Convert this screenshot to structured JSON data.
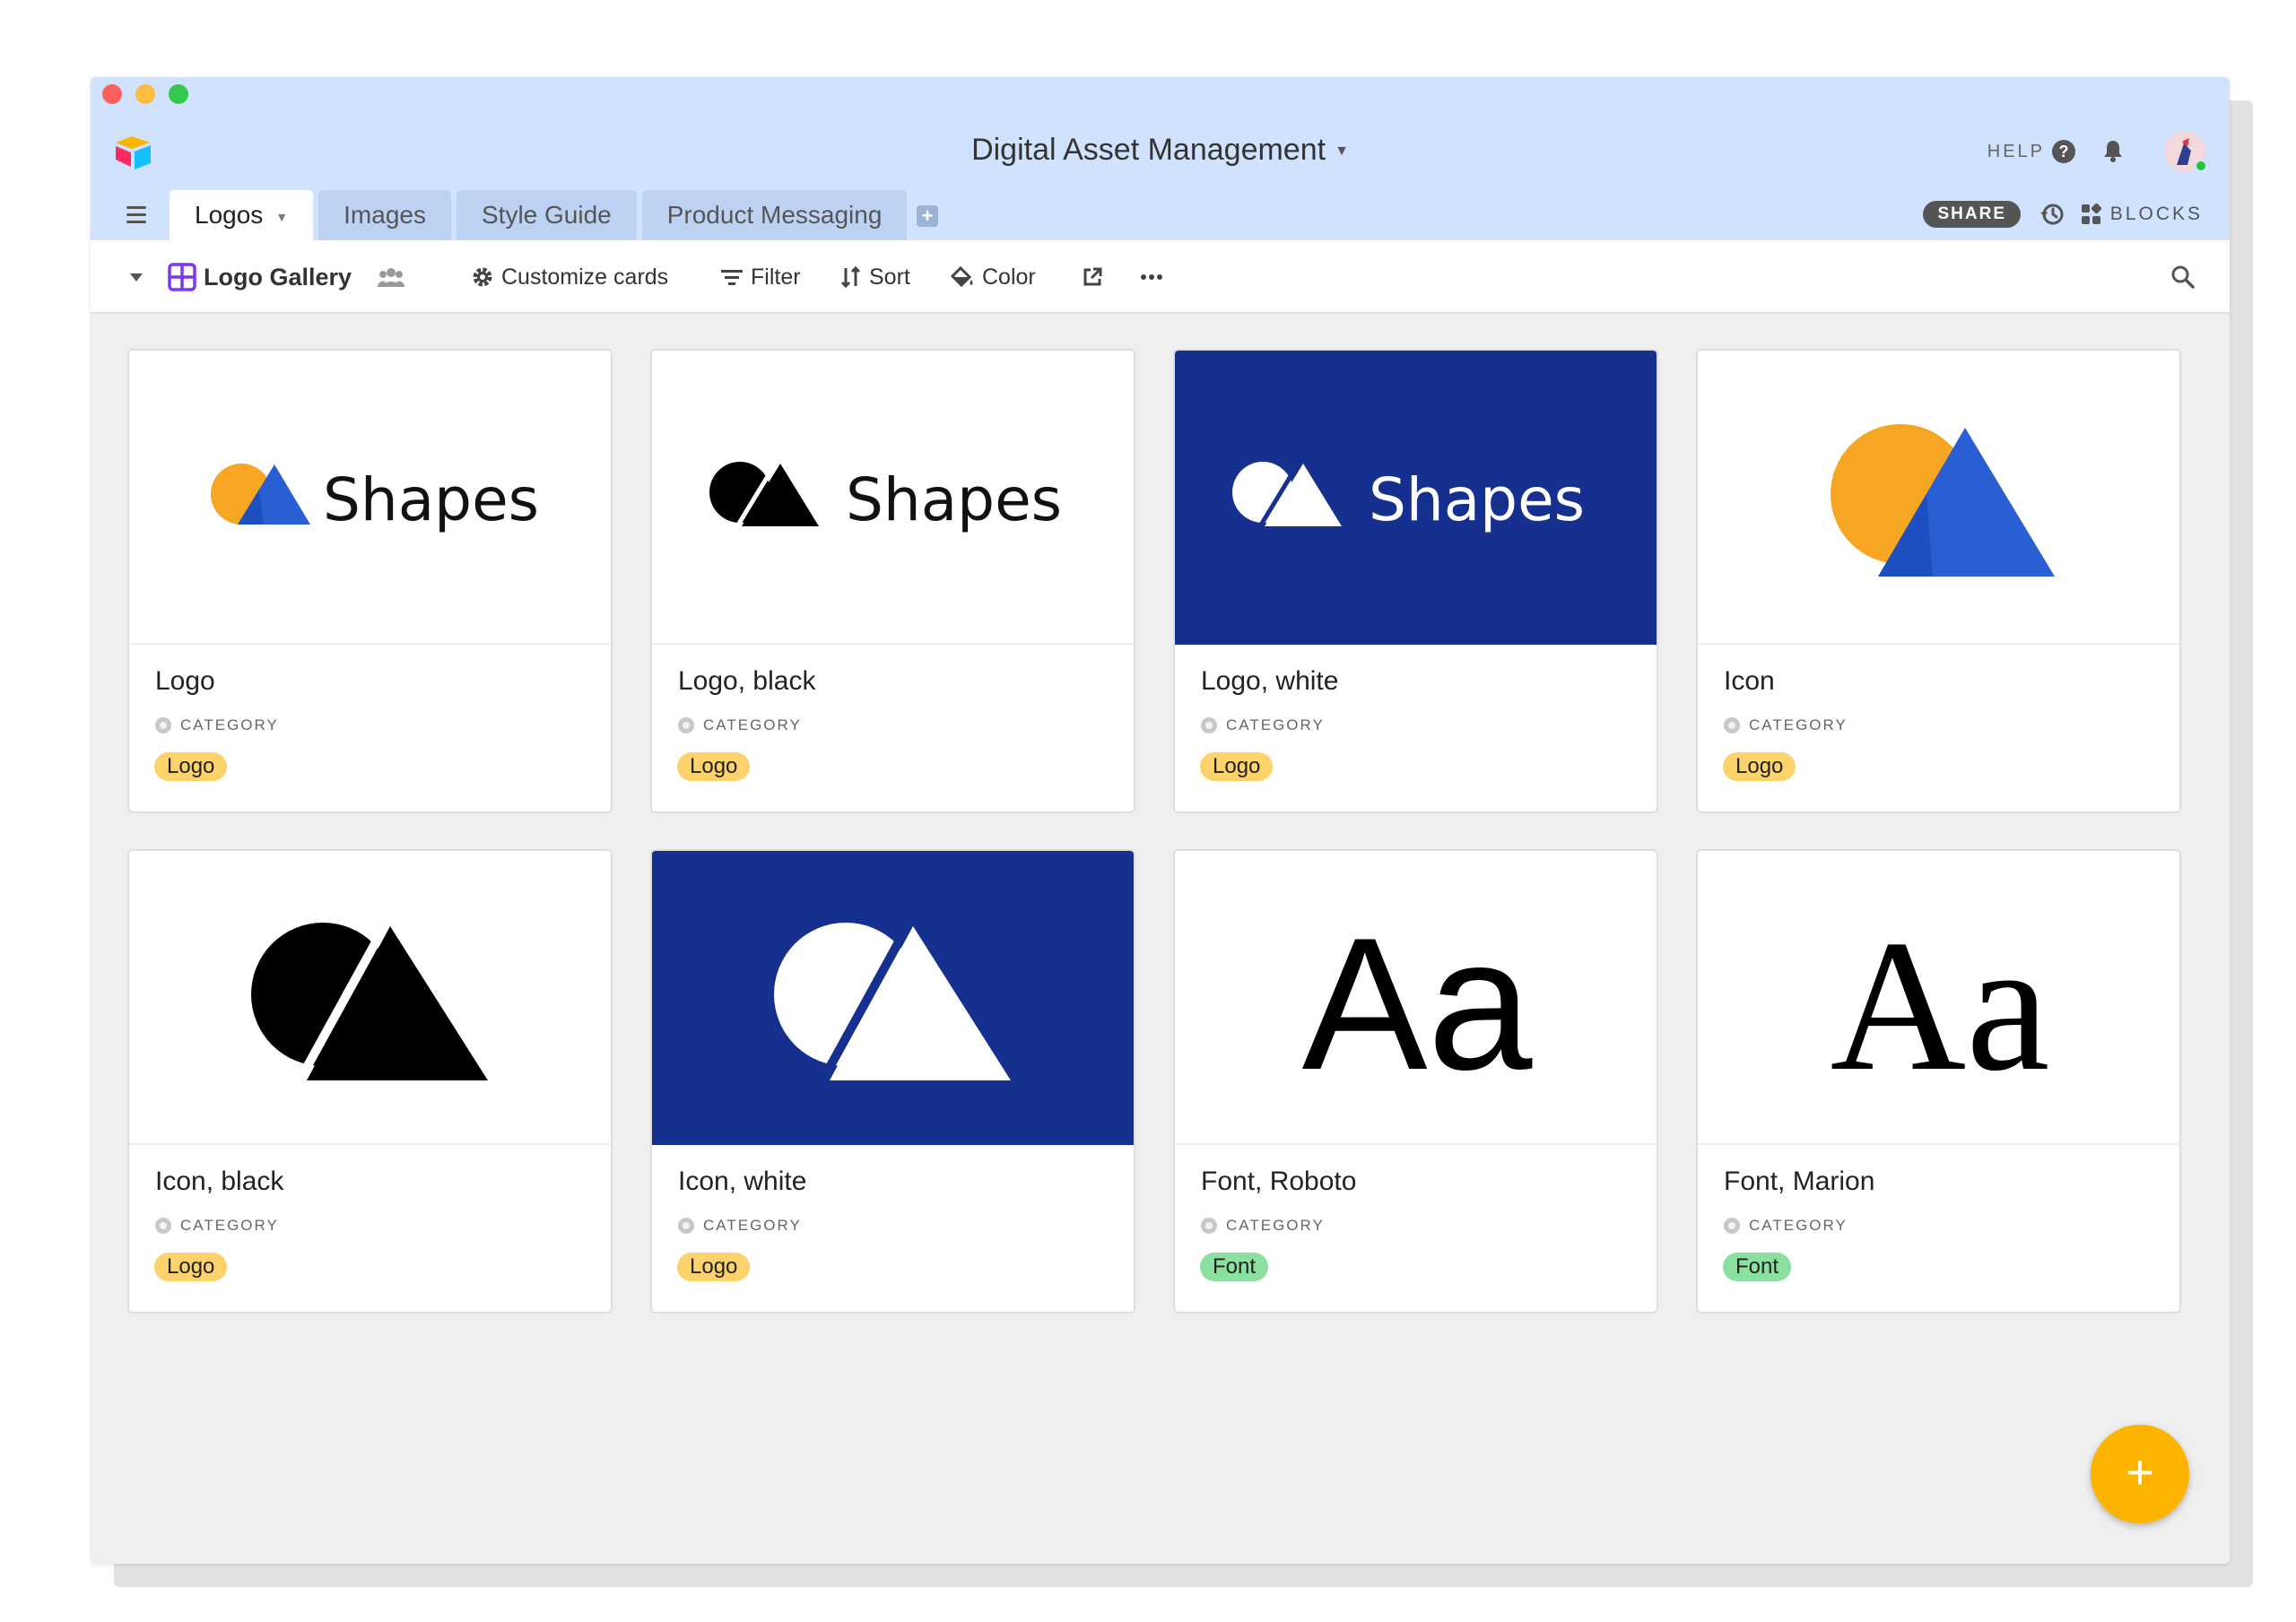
{
  "window": {
    "title": "Digital Asset Management",
    "help_label": "HELP",
    "share_label": "SHARE",
    "blocks_label": "BLOCKS"
  },
  "tabs": [
    {
      "label": "Logos",
      "active": true
    },
    {
      "label": "Images",
      "active": false
    },
    {
      "label": "Style Guide",
      "active": false
    },
    {
      "label": "Product Messaging",
      "active": false
    }
  ],
  "toolbar": {
    "view_name": "Logo Gallery",
    "customize_label": "Customize cards",
    "filter_label": "Filter",
    "sort_label": "Sort",
    "color_label": "Color"
  },
  "cards": [
    {
      "title": "Logo",
      "field_label": "CATEGORY",
      "category": "Logo",
      "media": "shapes-logo-color",
      "wordmark": "Shapes"
    },
    {
      "title": "Logo, black",
      "field_label": "CATEGORY",
      "category": "Logo",
      "media": "shapes-logo-black",
      "wordmark": "Shapes"
    },
    {
      "title": "Logo, white",
      "field_label": "CATEGORY",
      "category": "Logo",
      "media": "shapes-logo-white",
      "wordmark": "Shapes"
    },
    {
      "title": "Icon",
      "field_label": "CATEGORY",
      "category": "Logo",
      "media": "shapes-icon-color"
    },
    {
      "title": "Icon, black",
      "field_label": "CATEGORY",
      "category": "Logo",
      "media": "shapes-icon-black"
    },
    {
      "title": "Icon, white",
      "field_label": "CATEGORY",
      "category": "Logo",
      "media": "shapes-icon-white"
    },
    {
      "title": "Font, Roboto",
      "field_label": "CATEGORY",
      "category": "Font",
      "media": "font-sample-sans",
      "sample": "Aa"
    },
    {
      "title": "Font, Marion",
      "field_label": "CATEGORY",
      "category": "Font",
      "media": "font-sample-serif",
      "sample": "Aa"
    }
  ],
  "colors": {
    "titlebar": "#d1e2ff",
    "brand_blue": "#15308f",
    "logo_pill": "#fcd36b",
    "font_pill": "#8be0a0",
    "fab": "#fcb400",
    "view_icon": "#7c39ed"
  },
  "fab": {
    "label": "+"
  }
}
